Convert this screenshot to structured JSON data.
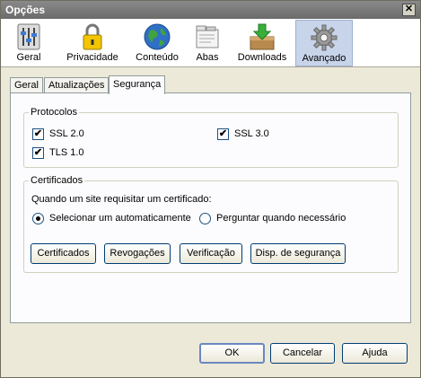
{
  "window": {
    "title": "Opções",
    "close_glyph": "✕"
  },
  "toolbar": {
    "panes": [
      {
        "label": "Geral",
        "icon": "sliders-icon"
      },
      {
        "label": "Privacidade",
        "icon": "padlock-icon"
      },
      {
        "label": "Conteúdo",
        "icon": "globe-icon"
      },
      {
        "label": "Abas",
        "icon": "tabs-icon"
      },
      {
        "label": "Downloads",
        "icon": "download-box-icon"
      },
      {
        "label": "Avançado",
        "icon": "gear-icon",
        "selected": true
      }
    ]
  },
  "tabs": [
    {
      "label": "Geral"
    },
    {
      "label": "Atualizações"
    },
    {
      "label": "Segurança",
      "selected": true
    }
  ],
  "protocols": {
    "legend": "Protocolos",
    "ssl2": {
      "label": "SSL 2.0",
      "checked": true
    },
    "ssl3": {
      "label": "SSL 3.0",
      "checked": true
    },
    "tls1": {
      "label": "TLS 1.0",
      "checked": true
    }
  },
  "certificates": {
    "legend": "Certificados",
    "prompt": "Quando um site requisitar um certificado:",
    "option_auto": {
      "label": "Selecionar um automaticamente",
      "selected": true
    },
    "option_ask": {
      "label": "Perguntar quando necessário",
      "selected": false
    },
    "buttons": {
      "certificates": "Certificados",
      "revocations": "Revogações",
      "verification": "Verificação",
      "security_devices": "Disp. de segurança"
    }
  },
  "footer": {
    "ok": "OK",
    "cancel": "Cancelar",
    "help": "Ajuda"
  },
  "colors": {
    "selected_pane": "#c8d4ea",
    "dialog_bg": "#ece9d8",
    "titlebar": "#7a7a7a"
  }
}
